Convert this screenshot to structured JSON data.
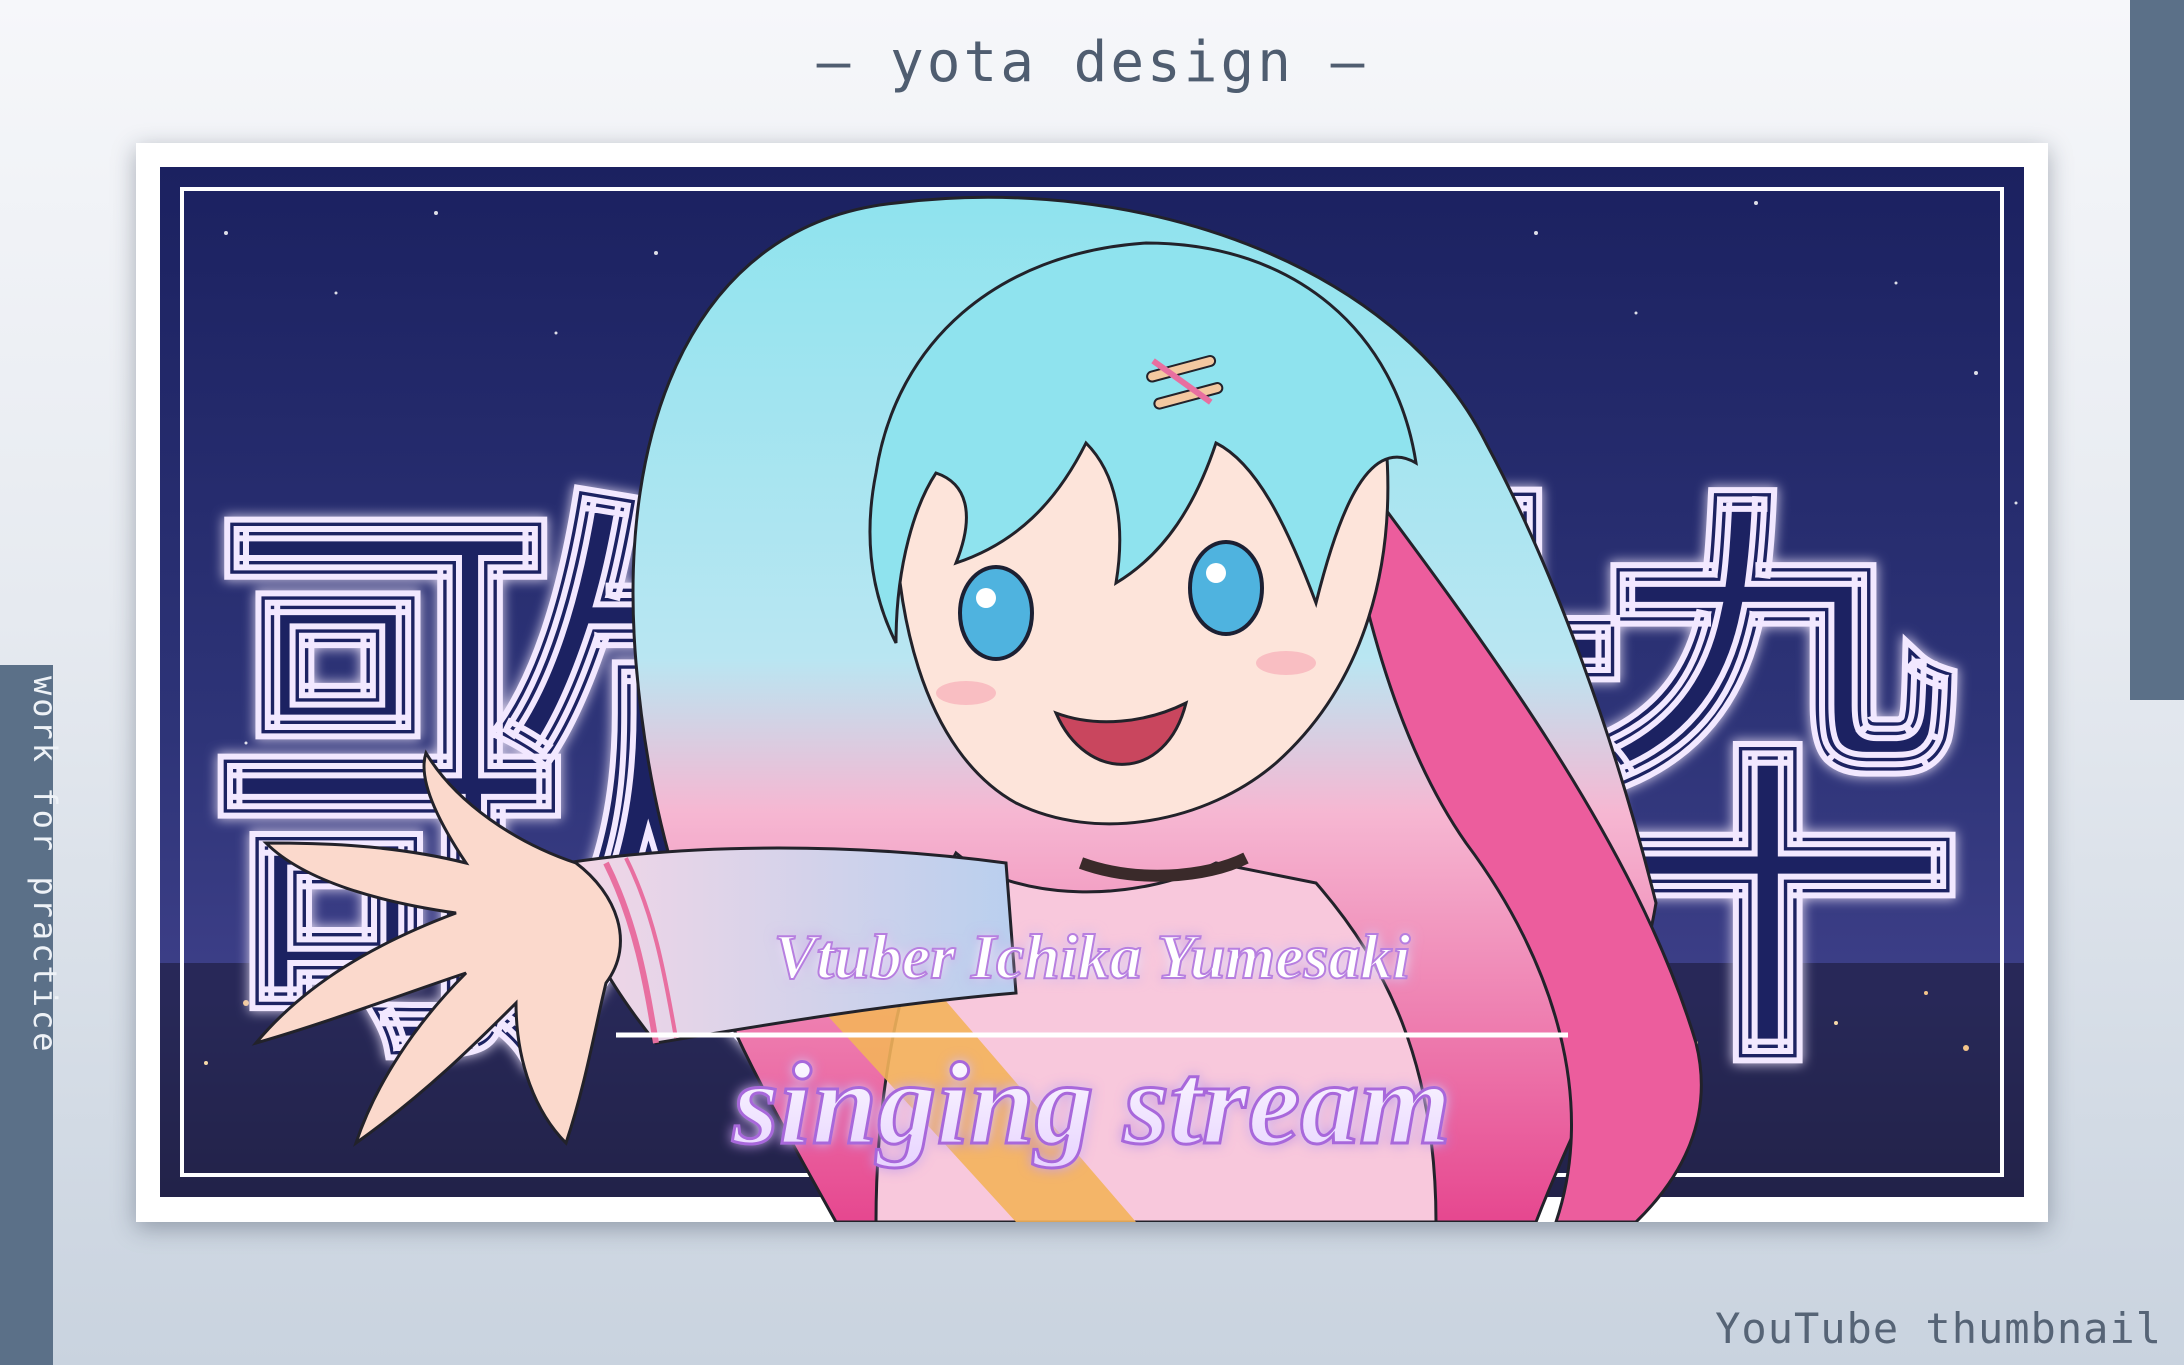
{
  "header": {
    "title": "– yota design –"
  },
  "side_label": "work for practice",
  "footer_label": "YouTube thumbnail",
  "thumbnail": {
    "kanji_left": "歌",
    "kanji_right": "枠",
    "subtitle": "Vtuber Ichika Yumesaki",
    "title": "singing stream"
  },
  "colors": {
    "accent_bar": "#5b7088",
    "sky_top": "#1b2160",
    "sky_bottom": "#3d3f88",
    "hair_top": "#8fe3ee",
    "hair_bottom": "#ec5d9d"
  },
  "icons": [
    "hair-clip-icon"
  ]
}
